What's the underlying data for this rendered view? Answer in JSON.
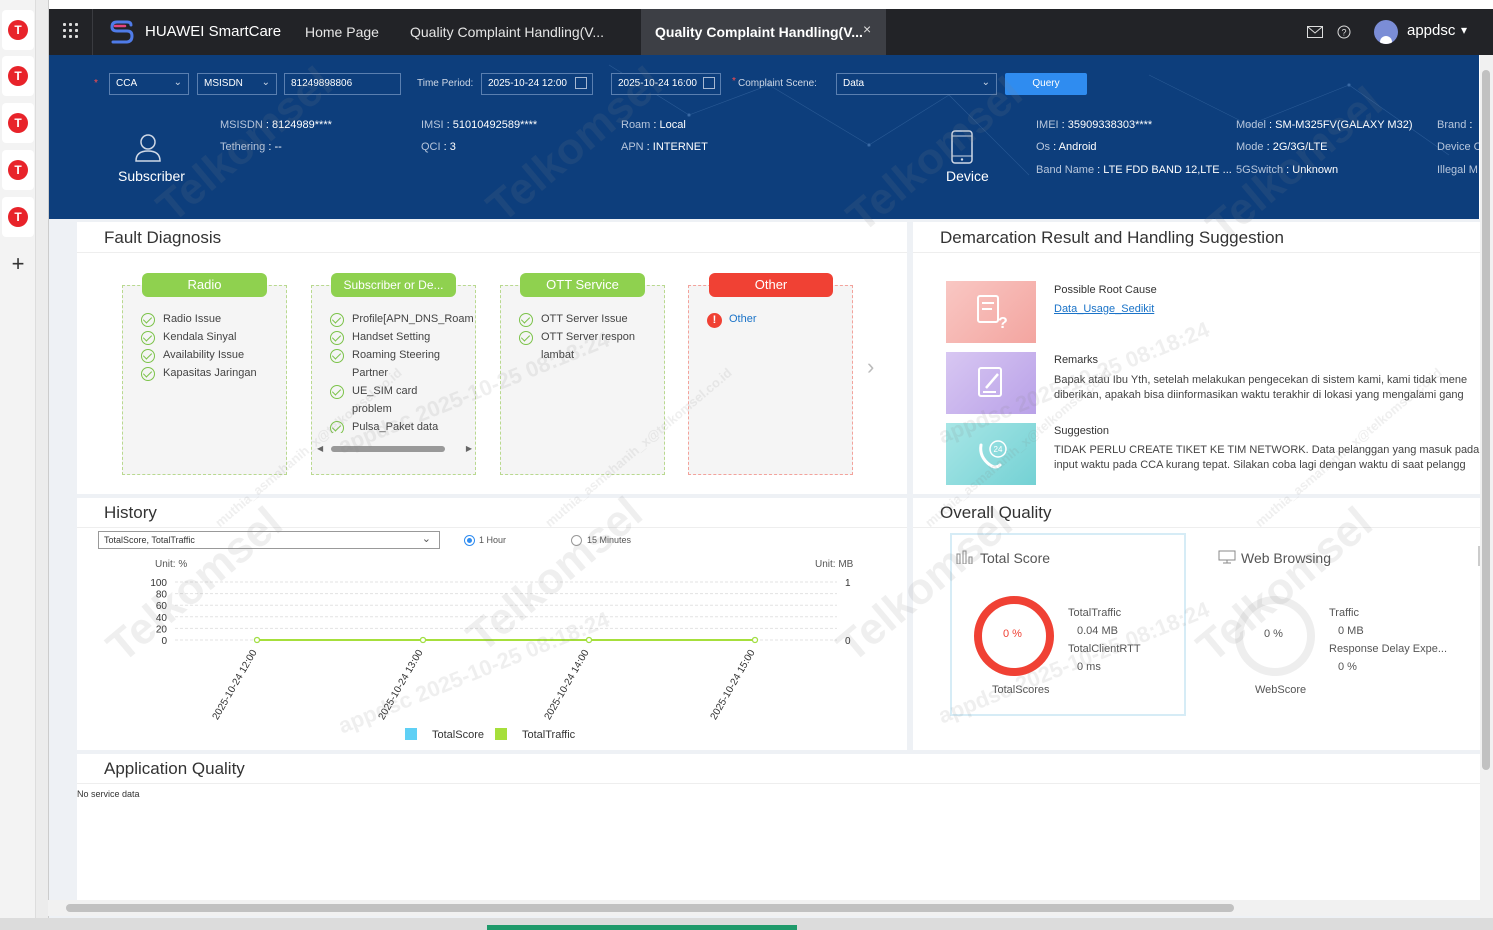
{
  "dock": {
    "items": [
      "T",
      "T",
      "T",
      "T",
      "T"
    ],
    "add": "+"
  },
  "nav": {
    "brand": "HUAWEI SmartCare",
    "links": [
      "Home Page",
      "Quality Complaint Handling(V..."
    ],
    "active_tab": "Quality Complaint Handling(V...",
    "close": "×",
    "user": "appdsc",
    "caret": "▾"
  },
  "query": {
    "type_value": "CCA",
    "id_type_value": "MSISDN",
    "number_value": "81249898806",
    "time_period_label": "Time Period:",
    "start_time": "2025-10-24 12:00",
    "end_time": "2025-10-24 16:00",
    "scene_label": "Complaint Scene:",
    "scene_value": "Data",
    "query_button": "Query",
    "required_mark": "*"
  },
  "subscriber": {
    "title": "Subscriber",
    "msisdn_k": "MSISDN",
    "msisdn_v": "8124989****",
    "tethering_k": "Tethering",
    "tethering_v": "--",
    "imsi_k": "IMSI",
    "imsi_v": "51010492589****",
    "qci_k": "QCI",
    "qci_v": "3",
    "roam_k": "Roam",
    "roam_v": "Local",
    "apn_k": "APN",
    "apn_v": "INTERNET"
  },
  "device": {
    "title": "Device",
    "imei_k": "IMEI",
    "imei_v": "35909338303****",
    "os_k": "Os",
    "os_v": "Android",
    "band_k": "Band Name",
    "band_v": "LTE FDD BAND 12,LTE ...",
    "model_k": "Model",
    "model_v": "SM-M325FV(GALAXY M32)",
    "mode_k": "Mode",
    "mode_v": "2G/3G/LTE",
    "fiveg_k": "5GSwitch",
    "fiveg_v": "Unknown",
    "brand_k": "Brand",
    "devicec_k": "Device C",
    "illegal_k": "Illegal M"
  },
  "fault": {
    "title": "Fault Diagnosis",
    "cards": [
      {
        "head": "Radio",
        "items": [
          "Radio Issue",
          "Kendala Sinyal",
          "Availability Issue",
          "Kapasitas Jaringan"
        ]
      },
      {
        "head": "Subscriber or De...",
        "items": [
          "Profile[APN_DNS_Roam",
          "Handset Setting",
          "Roaming Steering",
          "Partner",
          "UE_SIM card",
          "problem",
          "Pulsa_Paket data"
        ]
      },
      {
        "head": "OTT Service",
        "items": [
          "OTT Server Issue",
          "OTT Server respon",
          "lambat"
        ]
      },
      {
        "head": "Other",
        "items": [
          "Other"
        ]
      }
    ],
    "colors": {
      "green": "#8fd14f",
      "red": "#f04134"
    }
  },
  "demarcation": {
    "title": "Demarcation Result and Handling Suggestion",
    "root_cause_label": "Possible Root Cause",
    "root_cause_link": "Data_Usage_Sedikit",
    "remarks_label": "Remarks",
    "remarks_line1": "Bapak atau Ibu Yth, setelah melakukan pengecekan di sistem kami, kami tidak mene",
    "remarks_line2": "diberikan, apakah bisa diinformasikan waktu terakhir di lokasi yang mengalami gang",
    "suggestion_label": "Suggestion",
    "suggestion_line1": "TIDAK PERLU CREATE TIKET KE TIM NETWORK. Data pelanggan yang masuk pada sis",
    "suggestion_line2": "input waktu pada CCA kurang tepat. Silakan coba lagi dengan waktu di saat pelangg"
  },
  "history": {
    "title": "History",
    "metric_select": "TotalScore, TotalTraffic",
    "radio_1h": "1 Hour",
    "radio_15m": "15 Minutes"
  },
  "chart_data": {
    "type": "line",
    "x": [
      "2025-10-24 12:00",
      "2025-10-24 13:00",
      "2025-10-24 14:00",
      "2025-10-24 15:00"
    ],
    "left_unit": "Unit: %",
    "right_unit": "Unit: MB",
    "left_ticks": [
      100,
      80,
      60,
      40,
      20,
      0
    ],
    "right_ticks": [
      1,
      0
    ],
    "ylim_left": [
      0,
      100
    ],
    "ylim_right": [
      0,
      1
    ],
    "series": [
      {
        "name": "TotalScore",
        "color": "#5fd0f5",
        "values": [
          0,
          0,
          0,
          0
        ]
      },
      {
        "name": "TotalTraffic",
        "color": "#a6df3b",
        "values": [
          0,
          0,
          0,
          0
        ]
      }
    ],
    "legend_position": "bottom"
  },
  "overall": {
    "title": "Overall Quality",
    "total_title": "Total Score",
    "total_pct": "0 %",
    "total_traffic_label": "TotalTraffic",
    "total_traffic_value": "0.04 MB",
    "total_rtt_label": "TotalClientRTT",
    "total_rtt_value": "0 ms",
    "total_caption": "TotalScores",
    "web_title": "Web Browsing",
    "web_pct": "0 %",
    "web_traffic_label": "Traffic",
    "web_traffic_value": "0 MB",
    "web_delay_label": "Response Delay Expe...",
    "web_delay_value": "0 %",
    "web_caption": "WebScore",
    "score_pct": 0
  },
  "app_quality": {
    "title": "Application Quality",
    "empty": "No service data"
  },
  "watermark": {
    "brand": "Telkomsel",
    "stamp": "appdsc 2025-10-25 08:18:24",
    "email": "muthia_asmahanih_x@telkomsel.co.id"
  }
}
